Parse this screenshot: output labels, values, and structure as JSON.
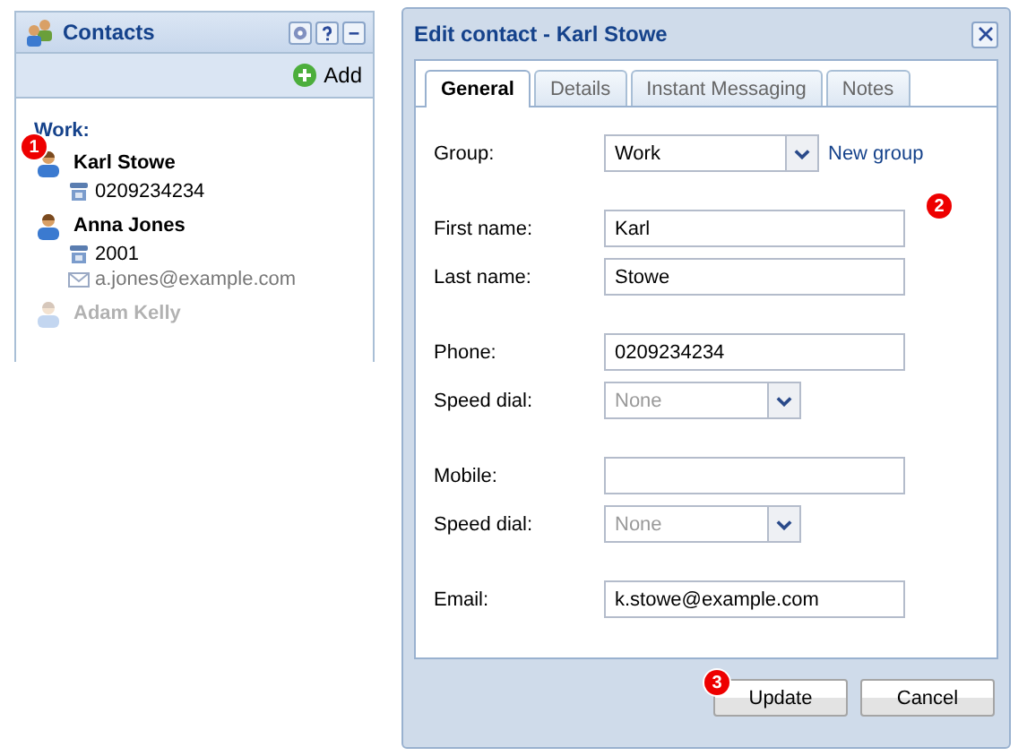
{
  "contacts_panel": {
    "title": "Contacts",
    "add_label": "Add",
    "group_label": "Work:",
    "contacts": [
      {
        "name": "Karl Stowe",
        "faded": false,
        "badge": "1",
        "details": [
          {
            "kind": "phone",
            "text": "0209234234"
          }
        ]
      },
      {
        "name": "Anna Jones",
        "faded": false,
        "details": [
          {
            "kind": "phone",
            "text": "2001"
          },
          {
            "kind": "email",
            "text": "a.jones@example.com"
          }
        ]
      },
      {
        "name": "Adam Kelly",
        "faded": true
      }
    ]
  },
  "dialog": {
    "title": "Edit contact - Karl Stowe",
    "tabs": [
      {
        "label": "General",
        "selected": true
      },
      {
        "label": "Details",
        "selected": false
      },
      {
        "label": "Instant Messaging",
        "selected": false
      },
      {
        "label": "Notes",
        "selected": false
      }
    ],
    "badge": "2",
    "groups": [
      {
        "fields": [
          {
            "label": "Group:",
            "kind": "select",
            "value": "Work",
            "disabled": false,
            "link": "New group"
          }
        ]
      },
      {
        "fields": [
          {
            "label": "First name:",
            "kind": "input",
            "value": "Karl"
          },
          {
            "label": "Last name:",
            "kind": "input",
            "value": "Stowe"
          }
        ]
      },
      {
        "fields": [
          {
            "label": "Phone:",
            "kind": "input",
            "value": "0209234234"
          },
          {
            "label": "Speed dial:",
            "kind": "select",
            "value": "None",
            "disabled": true
          }
        ]
      },
      {
        "fields": [
          {
            "label": "Mobile:",
            "kind": "input"
          },
          {
            "label": "Speed dial:",
            "kind": "select",
            "value": "None",
            "disabled": true
          }
        ]
      },
      {
        "fields": [
          {
            "label": "Email:",
            "kind": "input",
            "value": "k.stowe@example.com"
          }
        ]
      }
    ],
    "buttons": [
      {
        "label": "Update",
        "badge": "3"
      },
      {
        "label": "Cancel"
      }
    ]
  }
}
